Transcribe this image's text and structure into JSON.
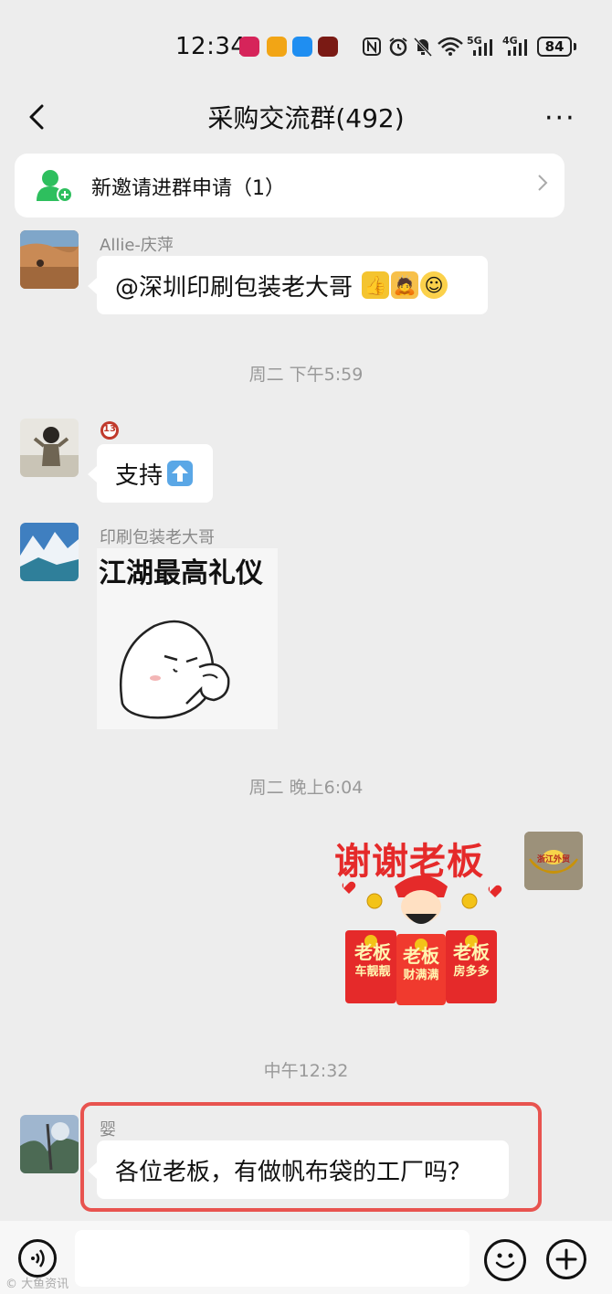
{
  "status_bar": {
    "time": "12:34",
    "network_5g": "5G",
    "network_4g": "4G",
    "battery": "84"
  },
  "header": {
    "title": "采购交流群(492)",
    "more": "···"
  },
  "invite_banner": {
    "text": "新邀请进群申请（1）"
  },
  "messages": [
    {
      "sender": "Allie-庆萍",
      "text": "@深圳印刷包装老大哥"
    },
    {
      "timestamp": "周二 下午5:59"
    },
    {
      "sender_badge": "13",
      "text": "支持"
    },
    {
      "sender": "印刷包装老大哥",
      "sticker_caption": "江湖最高礼仪"
    },
    {
      "timestamp": "周二 晚上6:04"
    },
    {
      "self_avatar_text": "浙江外贸",
      "sticker_title": "谢谢老板",
      "sticker_labels": [
        "老板",
        "车靓靓",
        "老板",
        "财满满",
        "老板",
        "房多多"
      ]
    },
    {
      "timestamp": "中午12:32"
    },
    {
      "sender": "婴",
      "text": "各位老板，有做帆布袋的工厂吗？"
    }
  ],
  "watermark": "© 大鱼资讯",
  "colors": {
    "background": "#ededed",
    "highlight": "#e8534f",
    "invite_icon": "#2ebf5e",
    "sticker_red": "#e52a2a"
  }
}
